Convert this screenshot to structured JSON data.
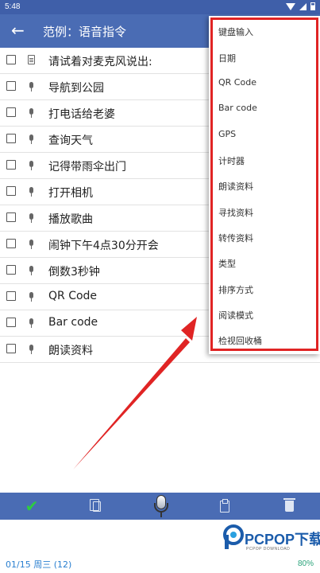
{
  "status_bar": {
    "time": "5:48"
  },
  "app_bar": {
    "title": "范例：语音指令"
  },
  "list": {
    "items": [
      {
        "label": "请试着对麦克风说出:",
        "icon": "note-icon"
      },
      {
        "label": "导航到公园",
        "icon": "microphone-icon"
      },
      {
        "label": "打电话给老婆",
        "icon": "microphone-icon"
      },
      {
        "label": "查询天气",
        "icon": "microphone-icon"
      },
      {
        "label": "记得带雨伞出门",
        "icon": "microphone-icon"
      },
      {
        "label": "打开相机",
        "icon": "microphone-icon"
      },
      {
        "label": "播放歌曲",
        "icon": "microphone-icon"
      },
      {
        "label": "闹钟下午4点30分开会",
        "icon": "microphone-icon"
      },
      {
        "label": "倒数3秒钟",
        "icon": "microphone-icon"
      },
      {
        "label": "QR Code",
        "icon": "microphone-icon"
      },
      {
        "label": "Bar code",
        "icon": "microphone-icon"
      },
      {
        "label": "朗读资料",
        "icon": "microphone-icon"
      }
    ]
  },
  "menu": {
    "items": [
      "键盘输入",
      "日期",
      "QR Code",
      "Bar code",
      "GPS",
      "计时器",
      "朗读资料",
      "寻找资料",
      "转传资料",
      "类型",
      "排序方式",
      "阅读模式",
      "检视回收桶"
    ]
  },
  "bottom_bar": {
    "icons": [
      "check-icon",
      "copy-icon",
      "microphone-icon",
      "clipboard-icon",
      "trash-icon"
    ]
  },
  "footer": {
    "date": "01/15 周三 (12)",
    "percent": "80%"
  },
  "watermark": {
    "brand": "PCPOP下载",
    "sub": "PCPOP DOWNLOAD"
  },
  "colors": {
    "app_bar": "#4a6cb4",
    "status_bar": "#3f5fa9",
    "highlight": "#e02424",
    "check": "#2ecc40"
  }
}
